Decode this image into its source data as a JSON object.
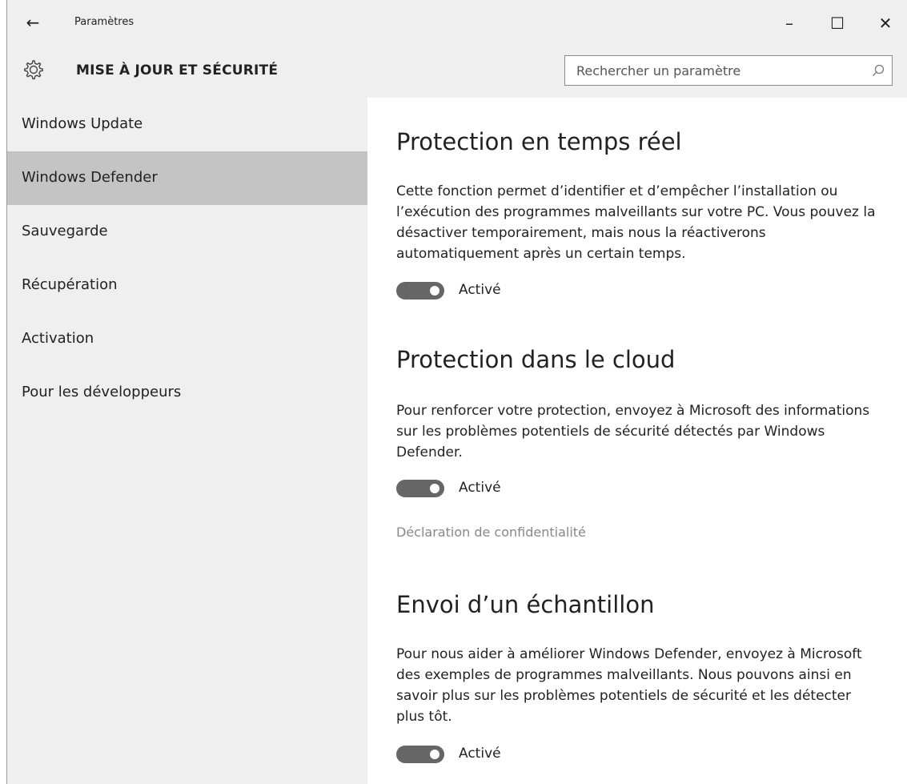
{
  "window": {
    "title": "Paramètres",
    "back_icon": "←",
    "minimize_icon": "–",
    "maximize_icon": "☐",
    "close_icon": "✕"
  },
  "header": {
    "title": "MISE À JOUR ET SÉCURITÉ",
    "icon": "gear-icon"
  },
  "search": {
    "placeholder": "Rechercher un paramètre",
    "value": "",
    "icon": "search-icon"
  },
  "sidebar": {
    "items": [
      {
        "label": "Windows Update",
        "selected": false
      },
      {
        "label": "Windows Defender",
        "selected": true
      },
      {
        "label": "Sauvegarde",
        "selected": false
      },
      {
        "label": "Récupération",
        "selected": false
      },
      {
        "label": "Activation",
        "selected": false
      },
      {
        "label": "Pour les développeurs",
        "selected": false
      }
    ]
  },
  "main": {
    "sections": [
      {
        "heading": "Protection en temps réel",
        "description": "Cette fonction permet d’identifier et d’empêcher l’installation ou l’exécution des programmes malveillants sur votre PC. Vous pouvez la désactiver temporairement, mais nous la réactiverons automatiquement après un certain temps.",
        "toggle_on": true,
        "toggle_label": "Activé"
      },
      {
        "heading": "Protection dans le cloud",
        "description": "Pour renforcer votre protection, envoyez à Microsoft des informations sur les problèmes potentiels de sécurité détectés par Windows Defender.",
        "toggle_on": true,
        "toggle_label": "Activé",
        "link": "Déclaration de confidentialité"
      },
      {
        "heading": "Envoi d’un échantillon",
        "description": "Pour nous aider à améliorer Windows Defender, envoyez à Microsoft des exemples de programmes malveillants. Nous pouvons ainsi en savoir plus sur les problèmes potentiels de sécurité et les détecter plus tôt.",
        "toggle_on": true,
        "toggle_label": "Activé"
      }
    ]
  },
  "colors": {
    "chrome_bg": "#efefef",
    "selected_bg": "#c4c4c4",
    "toggle_on": "#666666",
    "link": "#888888"
  }
}
